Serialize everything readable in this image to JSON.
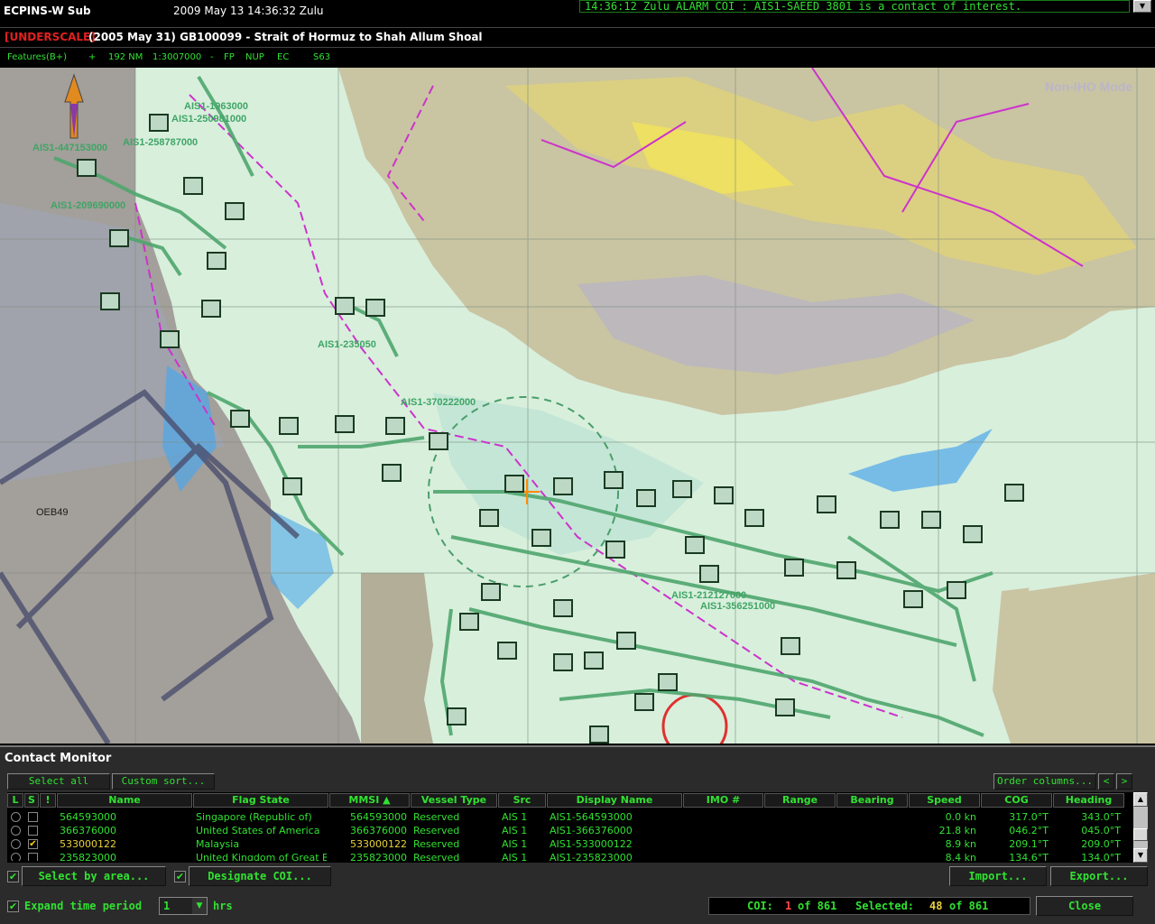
{
  "topbar": {
    "app_name": "ECPINS-W Sub",
    "datetime": "2009 May 13   14:36:32 Zulu",
    "alarm_text": "14:36:12 Zulu ALARM COI : AIS1-SAEED 3801 is a contact of interest.",
    "alarm_scroll_icon": "chevron-down-icon"
  },
  "chart": {
    "underscale": "[UNDERSCALE]",
    "title": "(2005 May 31) GB100099 - Strait of Hormuz to Shah Allum Shoal",
    "features": "Features(B+)",
    "plus": "+",
    "range": "192 NM",
    "scale": "1:3007000",
    "dash": "-",
    "fp": "FP",
    "nup": "NUP",
    "ec": "EC",
    "s63": "S63",
    "watermark": "Non-IHO Mode"
  },
  "map_labels": {
    "l1": "AIS1-447153000",
    "l2": "AIS1-258787000",
    "l3": "AIS1-209690000",
    "l4": "AIS1-370222000",
    "l5": "AIS1-235050",
    "l6": "AIS1-212127000",
    "l7": "AIS1-356251000",
    "l8": "OEB49",
    "l9": "AIS1-250981000",
    "l10": "AIS1-1963000"
  },
  "monitor": {
    "title": "Contact Monitor",
    "select_all": "Select all",
    "custom_sort": "Custom sort...",
    "order_columns": "Order columns...",
    "prev_icon": "chevron-left-icon",
    "next_icon": "chevron-right-icon",
    "columns": {
      "l": "L",
      "s": "S",
      "excl": "!",
      "name": "Name",
      "flag": "Flag State",
      "mmsi": "MMSI",
      "sort_icon": "▲",
      "vtype": "Vessel Type",
      "src": "Src",
      "display": "Display Name",
      "imo": "IMO #",
      "range": "Range",
      "bearing": "Bearing",
      "speed": "Speed",
      "cog": "COG",
      "heading": "Heading"
    },
    "rows": [
      {
        "name": "564593000",
        "flag": "Singapore (Republic of)",
        "mmsi": "564593000",
        "vtype": "Reserved",
        "src": "AIS 1",
        "display": "AIS1-564593000",
        "speed": "0.0 kn",
        "cog": "317.0°T",
        "heading": "343.0°T",
        "selected": false
      },
      {
        "name": "366376000",
        "flag": "United States of America",
        "mmsi": "366376000",
        "vtype": "Reserved",
        "src": "AIS 1",
        "display": "AIS1-366376000",
        "speed": "21.8 kn",
        "cog": "046.2°T",
        "heading": "045.0°T",
        "selected": false
      },
      {
        "name": "533000122",
        "flag": "Malaysia",
        "mmsi": "533000122",
        "vtype": "Reserved",
        "src": "AIS 1",
        "display": "AIS1-533000122",
        "speed": "8.9 kn",
        "cog": "209.1°T",
        "heading": "209.0°T",
        "selected": true
      },
      {
        "name": "235823000",
        "flag": "United Kingdom of Great B",
        "mmsi": "235823000",
        "vtype": "Reserved",
        "src": "AIS 1",
        "display": "AIS1-235823000",
        "speed": "8.4 kn",
        "cog": "134.6°T",
        "heading": "134.0°T",
        "selected": false
      }
    ],
    "select_by_area": "Select by area...",
    "designate_coi": "Designate COI...",
    "import": "Import...",
    "export": "Export...",
    "expand_time": "Expand time period",
    "time_value": "1",
    "hrs": "hrs",
    "coi_label": "COI:",
    "coi_count": "1",
    "of1": "of 861",
    "selected_label": "Selected:",
    "selected_count": "48",
    "of2": "of 861",
    "close": "Close",
    "check_mark": "✔"
  }
}
